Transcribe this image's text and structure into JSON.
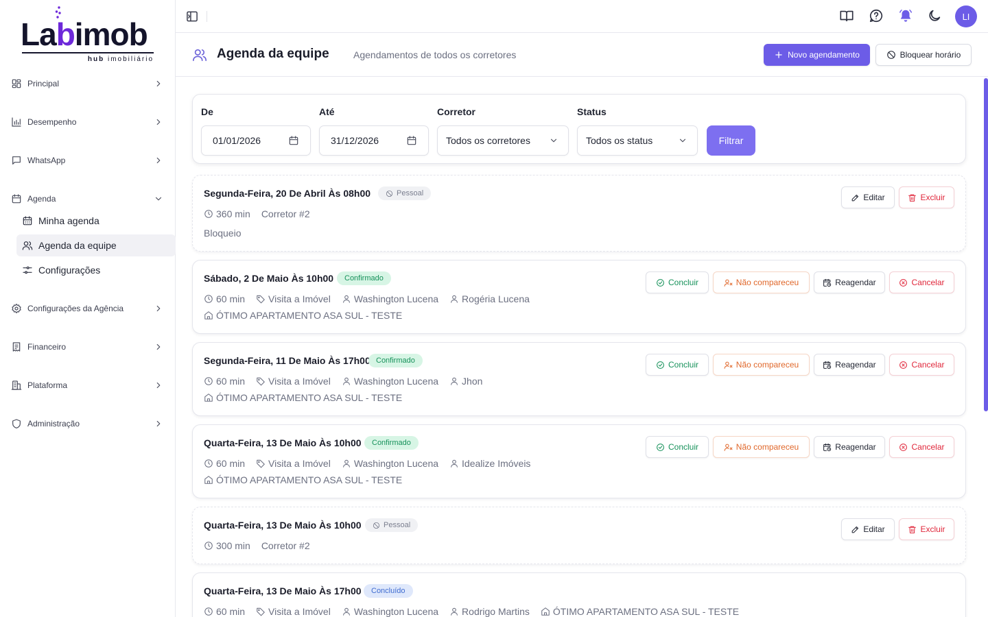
{
  "brand": {
    "name_part1": "La",
    "name_part2": "b",
    "name_part3": "imob",
    "tagline_bold": "hub",
    "tagline": "imobiliário"
  },
  "sidebar": {
    "items": [
      {
        "label": "Principal",
        "icon": "layout-grid-icon"
      },
      {
        "label": "Desempenho",
        "icon": "bar-chart-icon"
      },
      {
        "label": "WhatsApp",
        "icon": "message-square-icon"
      },
      {
        "label": "Agenda",
        "icon": "calendar-icon"
      },
      {
        "label": "Configurações da Agência",
        "icon": "settings-icon"
      },
      {
        "label": "Financeiro",
        "icon": "receipt-icon"
      },
      {
        "label": "Plataforma",
        "icon": "building-icon"
      },
      {
        "label": "Administração",
        "icon": "shield-icon"
      }
    ],
    "agenda_sub": [
      {
        "label": "Minha agenda",
        "icon": "calendar-days-icon"
      },
      {
        "label": "Agenda da equipe",
        "icon": "users-icon",
        "active": true
      },
      {
        "label": "Configurações",
        "icon": "sliders-icon"
      }
    ]
  },
  "topbar": {
    "avatar_initials": "LI"
  },
  "header": {
    "title": "Agenda da equipe",
    "subtitle": "Agendamentos de todos os corretores",
    "new_button": "Novo agendamento",
    "block_button": "Bloquear horário"
  },
  "filters": {
    "from_label": "De",
    "from_value": "01/01/2026",
    "to_label": "Até",
    "to_value": "31/12/2026",
    "broker_label": "Corretor",
    "broker_value": "Todos os corretores",
    "status_label": "Status",
    "status_value": "Todos os status",
    "submit": "Filtrar"
  },
  "actions": {
    "edit": "Editar",
    "delete": "Excluir",
    "complete": "Concluir",
    "no_show": "Não compareceu",
    "reschedule": "Reagendar",
    "cancel": "Cancelar"
  },
  "appointments": [
    {
      "title": "Segunda-Feira, 20 De Abril Às 08h00",
      "badge": "Pessoal",
      "duration": "360 min",
      "broker": "Corretor #2",
      "note": "Bloqueio"
    },
    {
      "title": "Sábado, 2 De Maio Às 10h00",
      "badge": "Confirmado",
      "duration": "60 min",
      "type": "Visita a Imóvel",
      "agent": "Washington Lucena",
      "client": "Rogéria Lucena",
      "property": "ÓTIMO APARTAMENTO ASA SUL - TESTE"
    },
    {
      "title": "Segunda-Feira, 11 De Maio Às 17h00",
      "badge": "Confirmado",
      "duration": "60 min",
      "type": "Visita a Imóvel",
      "agent": "Washington Lucena",
      "client": "Jhon",
      "property": "ÓTIMO APARTAMENTO ASA SUL - TESTE"
    },
    {
      "title": "Quarta-Feira, 13 De Maio Às 10h00",
      "badge": "Confirmado",
      "duration": "60 min",
      "type": "Visita a Imóvel",
      "agent": "Washington Lucena",
      "client": "Idealize Imóveis",
      "property": "ÓTIMO APARTAMENTO ASA SUL - TESTE"
    },
    {
      "title": "Quarta-Feira, 13 De Maio Às 10h00",
      "badge": "Pessoal",
      "duration": "300 min",
      "broker": "Corretor #2"
    },
    {
      "title": "Quarta-Feira, 13 De Maio Às 17h00",
      "badge": "Concluído",
      "duration": "60 min",
      "type": "Visita a Imóvel",
      "agent": "Washington Lucena",
      "client": "Rodrigo Martins",
      "property": "ÓTIMO APARTAMENTO ASA SUL - TESTE"
    }
  ],
  "colors": {
    "accent": "#6c5ce7",
    "confirmed": "#16915a",
    "warning": "#e0672a",
    "danger": "#e0263a",
    "completed": "#3e6bd0"
  }
}
